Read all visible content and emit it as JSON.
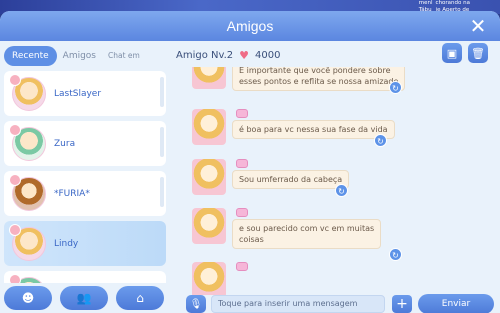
{
  "notification": {
    "line1a": "menl",
    "line1b": "Tábu",
    "line2a": "chorando na",
    "line2b": "ie Aperto de"
  },
  "window": {
    "title": "Amigos"
  },
  "tabs": [
    {
      "label": "Recente"
    },
    {
      "label": "Amigos"
    },
    {
      "label": "Chat em Grupo"
    }
  ],
  "friends": [
    {
      "name": "LastSlayer"
    },
    {
      "name": "Zura"
    },
    {
      "name": "*FURIA*"
    },
    {
      "name": "Lindy"
    }
  ],
  "header": {
    "level": "Amigo Nv.2",
    "points": "4000"
  },
  "messages": [
    {
      "text_line1": "É importante que você pondere sobre",
      "text_line2": "esses pontos e reflita se nossa amizade"
    },
    {
      "text_line1": "é boa para vc nessa sua fase da vida",
      "text_line2": ""
    },
    {
      "text_line1": "Sou umferrado da cabeça",
      "text_line2": ""
    },
    {
      "text_line1": "e sou parecido com vc em muitas",
      "text_line2": "coisas"
    }
  ],
  "input": {
    "placeholder": "Toque para inserir uma mensagem"
  },
  "send_label": "Enviar",
  "colors": {
    "accent": "#5e8fe5",
    "title_bar": "#6a95e6",
    "heart": "#ef6b86",
    "bubble": "#fbf2e4"
  }
}
